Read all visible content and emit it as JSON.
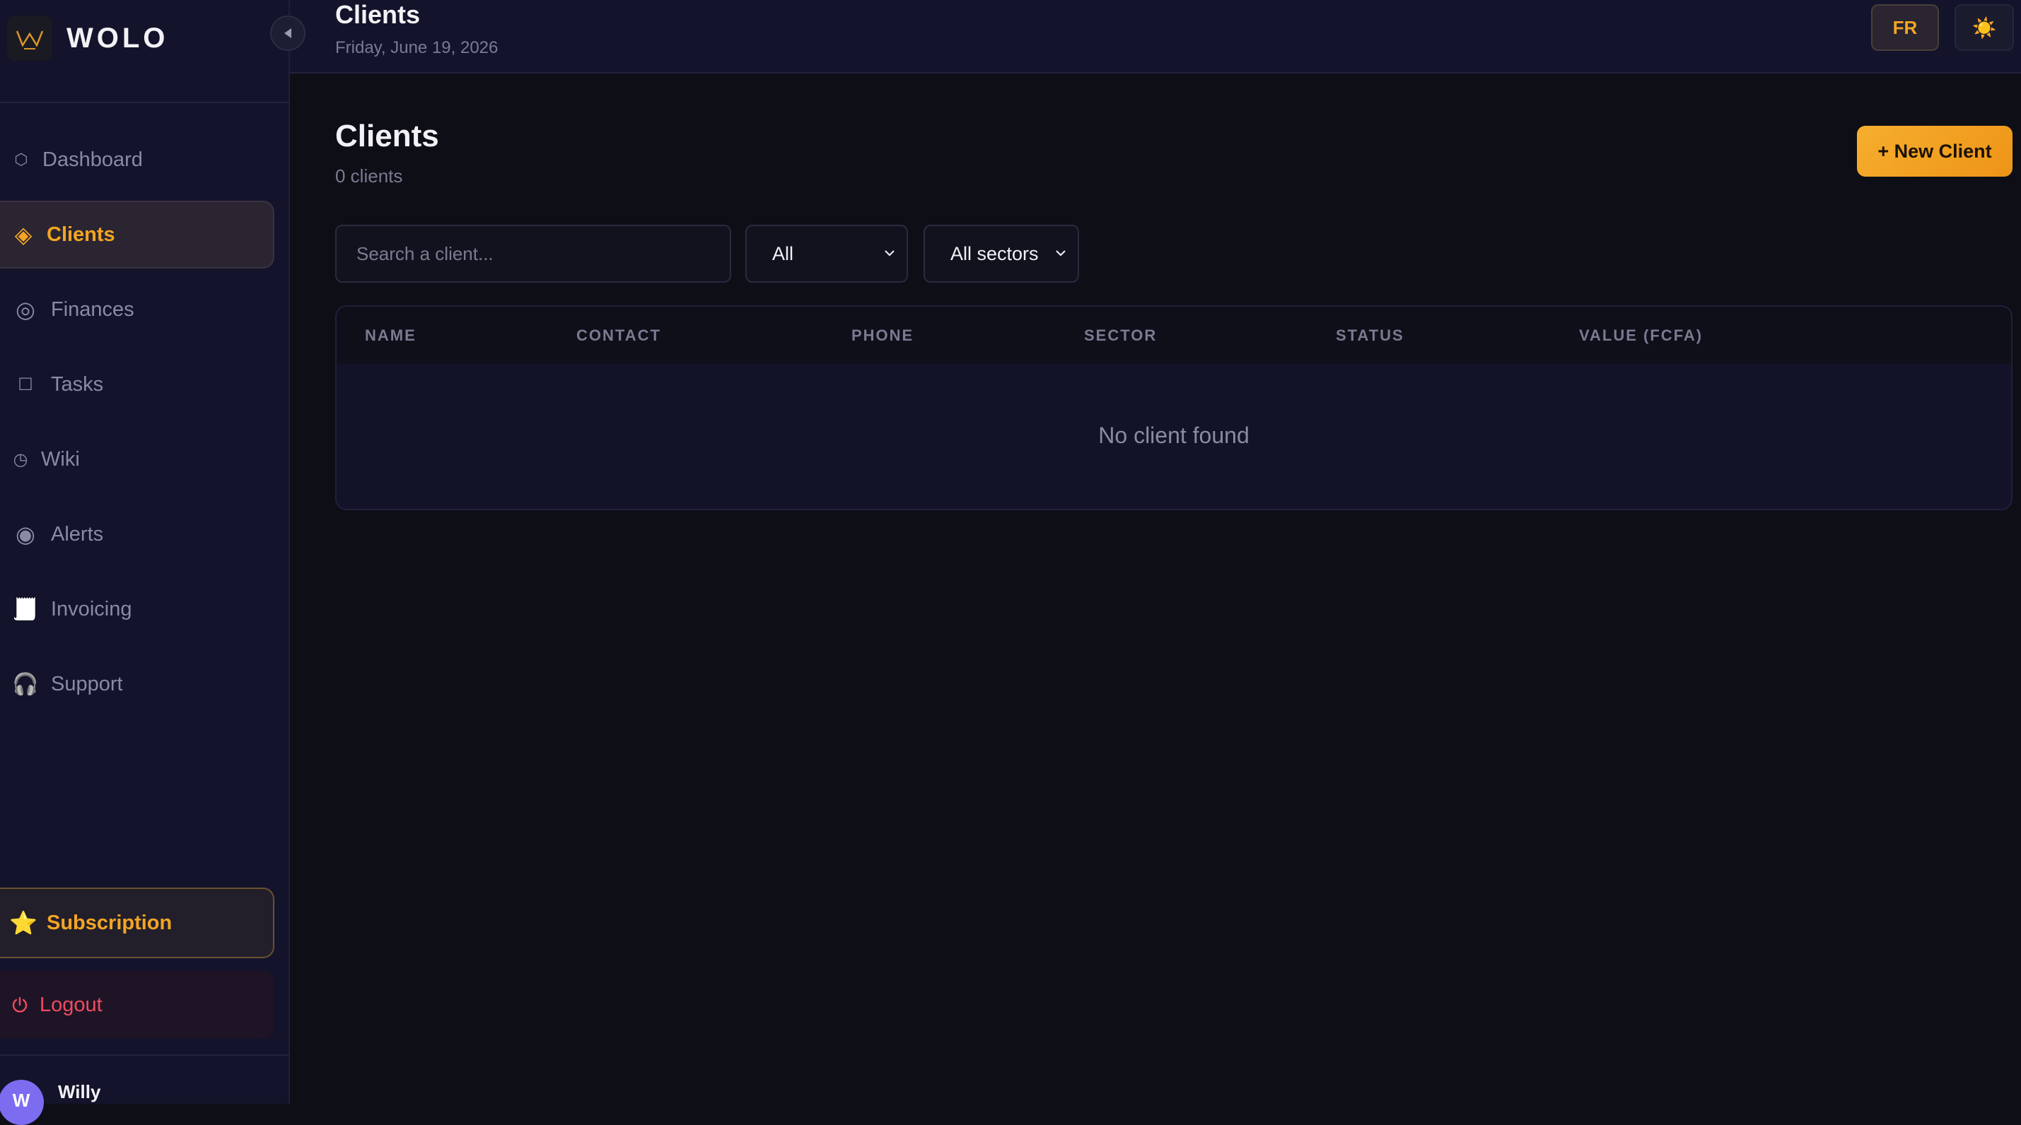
{
  "app": {
    "brand": "WOLO"
  },
  "sidebar": {
    "items": [
      {
        "label": "Dashboard",
        "icon": "hexagon-icon",
        "glyph": "⬡"
      },
      {
        "label": "Clients",
        "icon": "diamond-icon",
        "glyph": "◈",
        "active": true
      },
      {
        "label": "Finances",
        "icon": "ring-icon",
        "glyph": "◎"
      },
      {
        "label": "Tasks",
        "icon": "square-icon",
        "glyph": "☐"
      },
      {
        "label": "Wiki",
        "icon": "clock-icon",
        "glyph": "◷"
      },
      {
        "label": "Alerts",
        "icon": "record-icon",
        "glyph": "◉"
      },
      {
        "label": "Invoicing",
        "icon": "receipt-icon",
        "glyph": "🧾"
      },
      {
        "label": "Support",
        "icon": "headphones-icon",
        "glyph": "🎧"
      }
    ],
    "subscription": {
      "label": "Subscription",
      "glyph": "⭐"
    },
    "logout": {
      "label": "Logout"
    },
    "user": {
      "initial": "W",
      "name": "Willy"
    }
  },
  "topbar": {
    "title": "Clients",
    "date": "Friday, June 19, 2026",
    "lang": "FR",
    "theme_glyph": "☀️"
  },
  "main": {
    "title": "Clients",
    "count": "0 clients",
    "new_button": "+ New Client",
    "search_placeholder": "Search a client...",
    "status_filter": "All",
    "sector_filter": "All sectors",
    "columns": [
      "NAME",
      "CONTACT",
      "PHONE",
      "SECTOR",
      "STATUS",
      "VALUE (FCFA)"
    ],
    "empty": "No client found"
  },
  "colors": {
    "accent": "#f3a524",
    "danger": "#ee4c5f",
    "sidebar_bg": "#13132b",
    "page_bg": "#0e0e17",
    "avatar": "#7c6cf0"
  }
}
